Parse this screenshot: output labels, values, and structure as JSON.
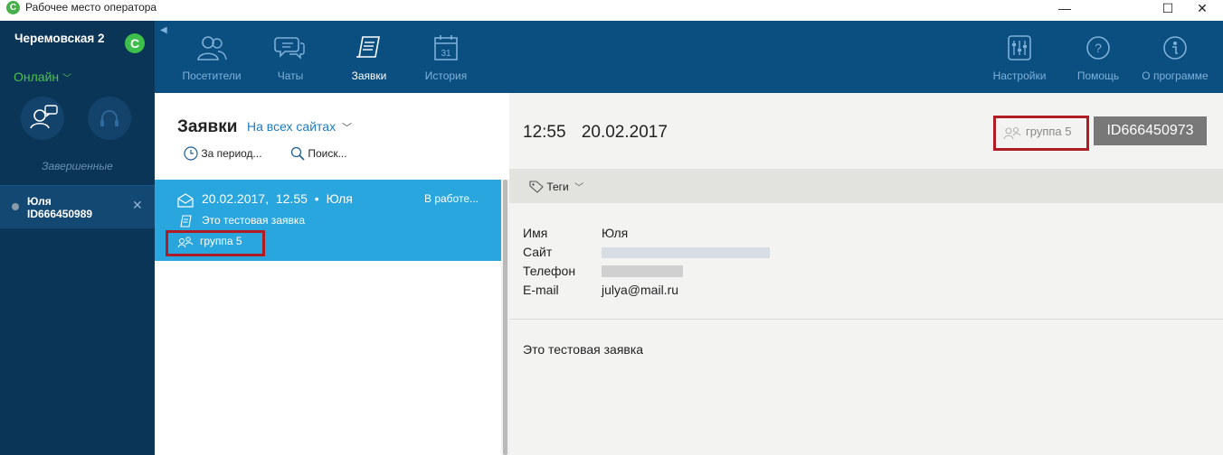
{
  "window": {
    "title": "Рабочее место оператора",
    "app_icon_letter": "C",
    "controls": {
      "minimize": "—",
      "maximize": "☐",
      "close": "✕"
    }
  },
  "sidebar": {
    "operator_name": "Черемовская 2",
    "brand_letter": "C",
    "status": "Онлайн",
    "section_label": "Завершенные",
    "chat_item": {
      "name": "Юля",
      "id": "ID666450989"
    }
  },
  "nav": {
    "items": [
      {
        "label": "Посетители",
        "icon": "visitors-icon",
        "active": false
      },
      {
        "label": "Чаты",
        "icon": "chat-bubbles-icon",
        "active": false
      },
      {
        "label": "Заявки",
        "icon": "requests-icon",
        "active": true
      },
      {
        "label": "История",
        "icon": "calendar-icon",
        "active": false
      }
    ],
    "right_items": [
      {
        "label": "Настройки",
        "icon": "settings-sliders-icon"
      },
      {
        "label": "Помощь",
        "icon": "help-icon"
      },
      {
        "label": "О программе",
        "icon": "info-icon"
      }
    ]
  },
  "requests": {
    "title": "Заявки",
    "filter": "На всех сайтах",
    "period_button": "За период...",
    "search_button": "Поиск...",
    "items": [
      {
        "date": "20.02.2017,",
        "time": "12.55",
        "separator": "•",
        "author": "Юля",
        "status": "В работе...",
        "text": "Это тестовая заявка",
        "group": "группа 5"
      }
    ]
  },
  "detail": {
    "time": "12:55",
    "date": "20.02.2017",
    "group": "группа 5",
    "id": "ID666450973",
    "tags_label": "Теги",
    "fields": [
      {
        "label": "Имя",
        "value": "Юля"
      },
      {
        "label": "Сайт",
        "value": ""
      },
      {
        "label": "Телефон",
        "value": ""
      },
      {
        "label": "E-mail",
        "value": "julya@mail.ru"
      }
    ],
    "message": "Это тестовая заявка"
  },
  "colors": {
    "sidebar_bg": "#0b3557",
    "nav_bg": "#0b4f81",
    "selected_item_bg": "#2aa6de",
    "status_online": "#4cc24e",
    "highlight_border": "#b01c24",
    "id_badge_bg": "#787878"
  }
}
